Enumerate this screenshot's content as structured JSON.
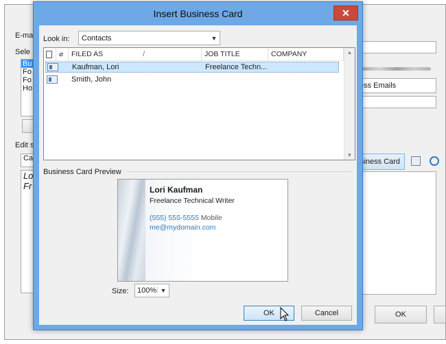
{
  "background": {
    "email_account_label": "E-ma",
    "select_label": "Sele",
    "sig_items": [
      "Bu",
      "Fo",
      "Fo",
      "Ho"
    ],
    "edit_label": "Edit s",
    "font_value": "Ca",
    "sig_text_lines": [
      "Lo",
      "Fr"
    ],
    "right_field_text": "ess Emails",
    "business_card_button": "siness Card",
    "ok_button": "OK"
  },
  "dialog": {
    "title": "Insert Business Card",
    "close_glyph": "✕",
    "look_in_label": "Look in:",
    "look_in_value": "Contacts",
    "columns": [
      "FILED AS",
      "JOB TITLE",
      "COMPANY"
    ],
    "sort_glyph": "/",
    "contacts": [
      {
        "filed_as": "Kaufman, Lori",
        "job_title": "Freelance Techn...",
        "company": "",
        "selected": true
      },
      {
        "filed_as": "Smith, John",
        "job_title": "",
        "company": "",
        "selected": false
      }
    ],
    "preview_label": "Business Card Preview",
    "card": {
      "name": "Lori Kaufman",
      "title": "Freelance Technical Writer",
      "phone": "(555) 555-5555",
      "phone_type": "Mobile",
      "email": "me@mydomain.com"
    },
    "size_label": "Size:",
    "size_value": "100%",
    "ok_label": "OK",
    "cancel_label": "Cancel"
  },
  "colors": {
    "title_bar": "#6ea8e6",
    "close_button": "#c74a3c",
    "selected_row": "#cce8ff",
    "link_blue": "#2f7ebc"
  }
}
